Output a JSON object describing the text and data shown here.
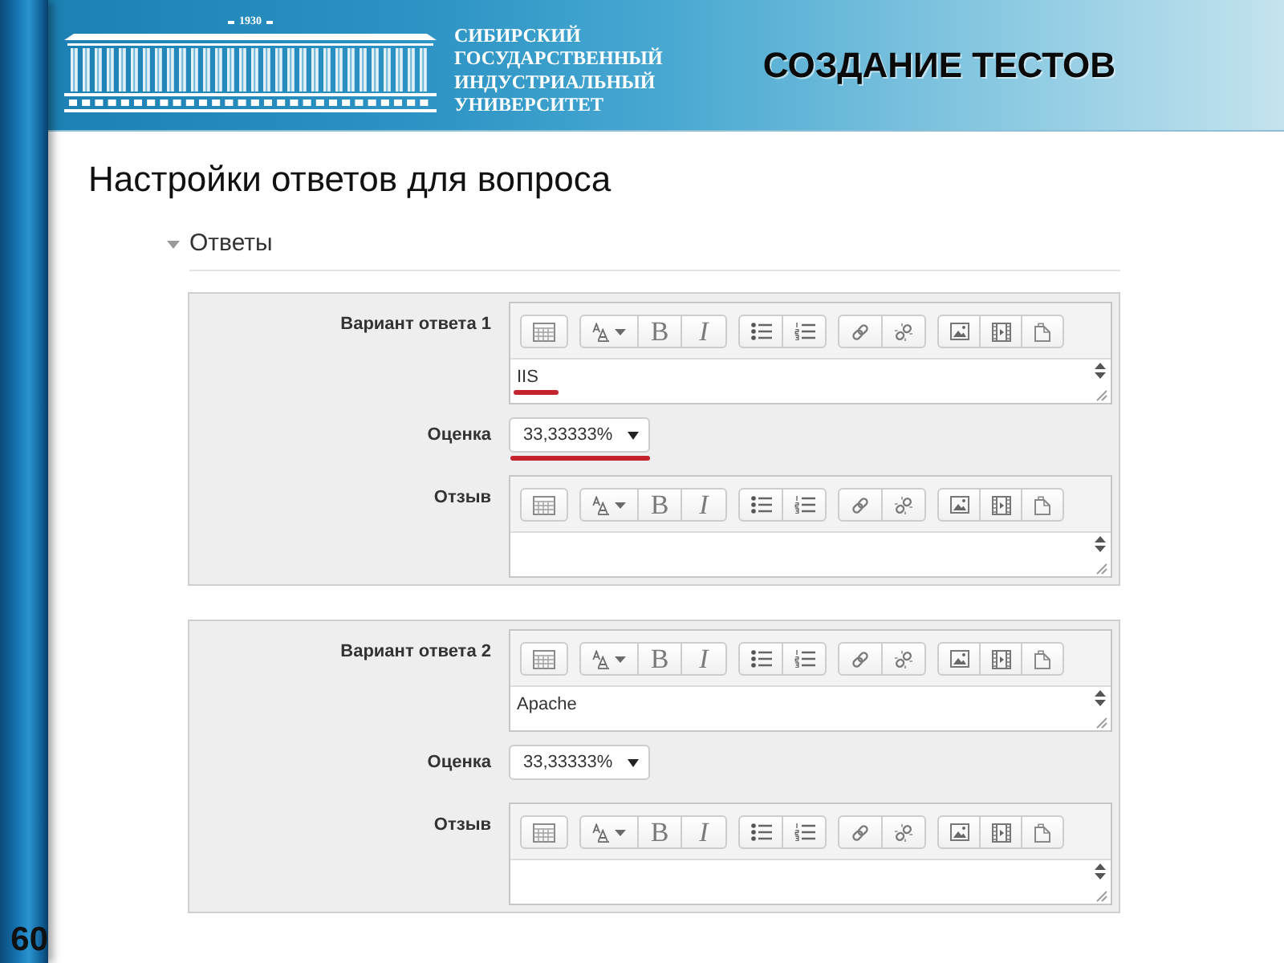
{
  "header": {
    "year": "1930",
    "university": "СИБИРСКИЙ ГОСУДАРСТВЕННЫЙ ИНДУСТРИАЛЬНЫЙ УНИВЕРСИТЕТ",
    "title": "СОЗДАНИЕ ТЕСТОВ"
  },
  "heading": "Настройки ответов для вопроса",
  "section": {
    "title": "Ответы",
    "expanded": true
  },
  "answers": [
    {
      "label": "Вариант ответа 1",
      "answer_editor": {
        "bold": "B",
        "italic": "I",
        "text": "IIS"
      },
      "text_underlined": true,
      "grade_label": "Оценка",
      "grade": "33,33333%",
      "grade_underlined": true,
      "feedback_label": "Отзыв",
      "feedback_editor": {
        "bold": "B",
        "italic": "I"
      }
    },
    {
      "label": "Вариант ответа 2",
      "answer_editor": {
        "bold": "B",
        "italic": "I",
        "text": "Apache"
      },
      "text_underlined": false,
      "grade_label": "Оценка",
      "grade": "33,33333%",
      "grade_underlined": false,
      "feedback_label": "Отзыв",
      "feedback_editor": {
        "bold": "B",
        "italic": "I"
      }
    }
  ],
  "slide_number": "60"
}
